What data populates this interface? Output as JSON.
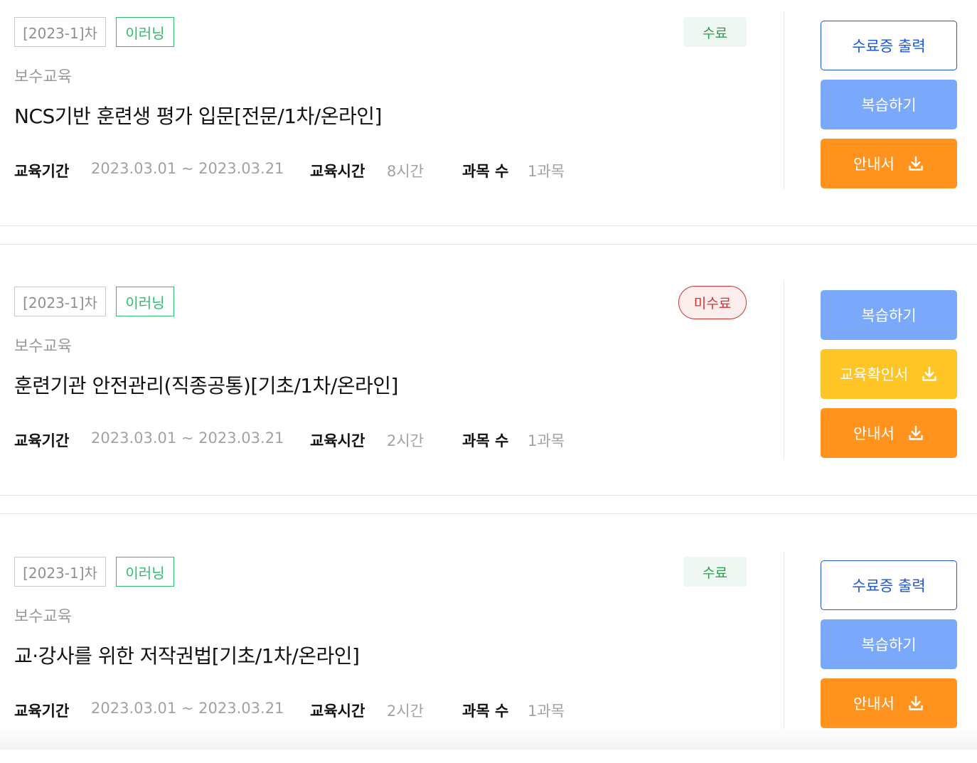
{
  "labels": {
    "period": "교육기간",
    "hours": "교육시간",
    "subjects": "과목 수"
  },
  "courses": [
    {
      "round": "[2023-1]차",
      "type": "이러닝",
      "category": "보수교육",
      "title": "NCS기반 훈련생 평가 입문[전문/1차/온라인]",
      "period": "2023.03.01 ~ 2023.03.21",
      "hours": "8시간",
      "subjects": "1과목",
      "status": "수료",
      "buttons": [
        "수료증 출력",
        "복습하기",
        "안내서"
      ]
    },
    {
      "round": "[2023-1]차",
      "type": "이러닝",
      "category": "보수교육",
      "title": "훈련기관 안전관리(직종공통)[기초/1차/온라인]",
      "period": "2023.03.01 ~ 2023.03.21",
      "hours": "2시간",
      "subjects": "1과목",
      "status": "미수료",
      "buttons": [
        "복습하기",
        "교육확인서",
        "안내서"
      ]
    },
    {
      "round": "[2023-1]차",
      "type": "이러닝",
      "category": "보수교육",
      "title": "교·강사를 위한 저작권법[기초/1차/온라인]",
      "period": "2023.03.01 ~ 2023.03.21",
      "hours": "2시간",
      "subjects": "1과목",
      "status": "수료",
      "buttons": [
        "수료증 출력",
        "복습하기",
        "안내서"
      ]
    }
  ]
}
